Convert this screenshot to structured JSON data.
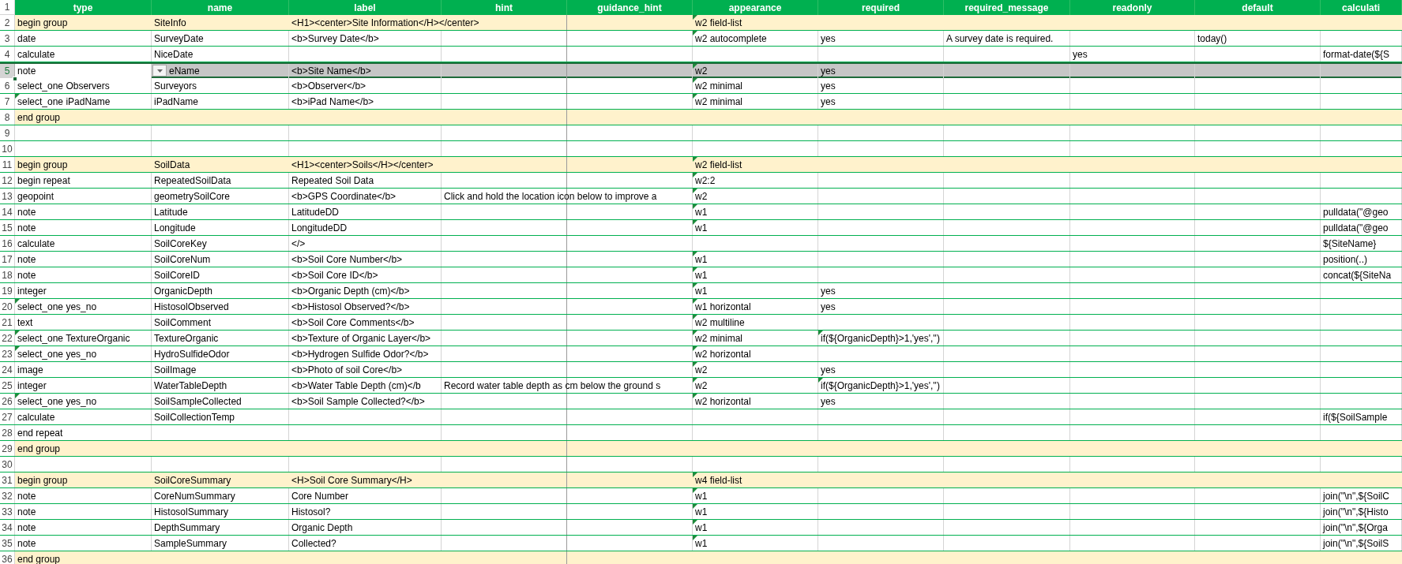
{
  "header": {
    "number": "1",
    "columns": [
      "type",
      "name",
      "label",
      "hint",
      "guidance_hint",
      "appearance",
      "required",
      "required_message",
      "readonly",
      "default",
      "calculati"
    ]
  },
  "rows": [
    {
      "number": "2",
      "kind": "group",
      "selected": false,
      "cells": {
        "type": {
          "text": "begin group",
          "comment": false
        },
        "name": {
          "text": "SiteInfo",
          "comment": false
        },
        "label": {
          "text": "<H1><center>Site Information</H></center>",
          "comment": false
        },
        "appearance": {
          "text": "w2 field-list",
          "comment": true
        }
      }
    },
    {
      "number": "3",
      "kind": "field",
      "selected": false,
      "cells": {
        "type": {
          "text": "date",
          "comment": false
        },
        "name": {
          "text": "SurveyDate",
          "comment": false
        },
        "label": {
          "text": "<b>Survey Date</b>",
          "comment": false
        },
        "appearance": {
          "text": "w2 autocomplete",
          "comment": true
        },
        "required": {
          "text": "yes",
          "comment": false
        },
        "required_message": {
          "text": "A survey date is required.",
          "comment": false
        },
        "default": {
          "text": "today()",
          "comment": false
        }
      }
    },
    {
      "number": "4",
      "kind": "field",
      "selected": false,
      "cells": {
        "type": {
          "text": "calculate",
          "comment": false
        },
        "name": {
          "text": "NiceDate",
          "comment": false
        },
        "readonly": {
          "text": "yes",
          "comment": false
        },
        "calculation": {
          "text": "format-date(${S",
          "comment": false
        }
      }
    },
    {
      "number": "5",
      "kind": "field",
      "selected": true,
      "cells": {
        "type": {
          "text": "note",
          "comment": false
        },
        "name": {
          "text": "eName",
          "comment": false
        },
        "label": {
          "text": "<b>Site Name</b>",
          "comment": false
        },
        "appearance": {
          "text": "w2",
          "comment": true
        },
        "required": {
          "text": "yes",
          "comment": false
        }
      }
    },
    {
      "number": "6",
      "kind": "field",
      "selected": false,
      "cells": {
        "type": {
          "text": "select_one Observers",
          "comment": false
        },
        "name": {
          "text": "Surveyors",
          "comment": false
        },
        "label": {
          "text": "<b>Observer</b>",
          "comment": false
        },
        "appearance": {
          "text": "w2 minimal",
          "comment": true
        },
        "required": {
          "text": "yes",
          "comment": false
        }
      }
    },
    {
      "number": "7",
      "kind": "field",
      "selected": false,
      "cells": {
        "type": {
          "text": "select_one iPadName",
          "comment": true
        },
        "name": {
          "text": "iPadName",
          "comment": false
        },
        "label": {
          "text": "<b>iPad Name</b>",
          "comment": false
        },
        "appearance": {
          "text": "w2 minimal",
          "comment": true
        },
        "required": {
          "text": "yes",
          "comment": false
        }
      }
    },
    {
      "number": "8",
      "kind": "group",
      "selected": false,
      "cells": {
        "type": {
          "text": "end group",
          "comment": false
        }
      }
    },
    {
      "number": "9",
      "kind": "field",
      "selected": false
    },
    {
      "number": "10",
      "kind": "field",
      "selected": false
    },
    {
      "number": "11",
      "kind": "group",
      "selected": false,
      "cells": {
        "type": {
          "text": "begin group",
          "comment": false
        },
        "name": {
          "text": "SoilData",
          "comment": false
        },
        "label": {
          "text": "<H1><center>Soils</H></center>",
          "comment": false
        },
        "appearance": {
          "text": "w2 field-list",
          "comment": true
        }
      }
    },
    {
      "number": "12",
      "kind": "field",
      "selected": false,
      "cells": {
        "type": {
          "text": "begin repeat",
          "comment": false
        },
        "name": {
          "text": "RepeatedSoilData",
          "comment": false
        },
        "label": {
          "text": "Repeated Soil Data",
          "comment": false
        },
        "appearance": {
          "text": "w2:2",
          "comment": true
        }
      }
    },
    {
      "number": "13",
      "kind": "field",
      "selected": false,
      "cells": {
        "type": {
          "text": "geopoint",
          "comment": false
        },
        "name": {
          "text": "geometrySoilCore",
          "comment": false
        },
        "label": {
          "text": "<b>GPS Coordinate</b>",
          "comment": false
        },
        "hint": {
          "text": "Click and hold the location icon below to improve a",
          "comment": false
        },
        "appearance": {
          "text": "w2",
          "comment": true
        }
      }
    },
    {
      "number": "14",
      "kind": "field",
      "selected": false,
      "cells": {
        "type": {
          "text": "note",
          "comment": false
        },
        "name": {
          "text": "Latitude",
          "comment": false
        },
        "label": {
          "text": "LatitudeDD",
          "comment": false
        },
        "appearance": {
          "text": "w1",
          "comment": true
        },
        "calculation": {
          "text": "pulldata(\"@geo",
          "comment": false
        }
      }
    },
    {
      "number": "15",
      "kind": "field",
      "selected": false,
      "cells": {
        "type": {
          "text": "note",
          "comment": false
        },
        "name": {
          "text": "Longitude",
          "comment": false
        },
        "label": {
          "text": "LongitudeDD",
          "comment": false
        },
        "appearance": {
          "text": "w1",
          "comment": true
        },
        "calculation": {
          "text": "pulldata(\"@geo",
          "comment": false
        }
      }
    },
    {
      "number": "16",
      "kind": "field",
      "selected": false,
      "cells": {
        "type": {
          "text": "calculate",
          "comment": false
        },
        "name": {
          "text": "SoilCoreKey",
          "comment": false
        },
        "label": {
          "text": "</>",
          "comment": false
        },
        "calculation": {
          "text": "${SiteName}",
          "comment": false
        }
      }
    },
    {
      "number": "17",
      "kind": "field",
      "selected": false,
      "cells": {
        "type": {
          "text": "note",
          "comment": false
        },
        "name": {
          "text": "SoilCoreNum",
          "comment": false
        },
        "label": {
          "text": "<b>Soil Core Number</b>",
          "comment": false
        },
        "appearance": {
          "text": "w1",
          "comment": true
        },
        "calculation": {
          "text": "position(..)",
          "comment": false
        }
      }
    },
    {
      "number": "18",
      "kind": "field",
      "selected": false,
      "cells": {
        "type": {
          "text": "note",
          "comment": false
        },
        "name": {
          "text": "SoilCoreID",
          "comment": false
        },
        "label": {
          "text": "<b>Soil Core ID</b>",
          "comment": false
        },
        "appearance": {
          "text": "w1",
          "comment": true
        },
        "calculation": {
          "text": "concat(${SiteNa",
          "comment": false
        }
      }
    },
    {
      "number": "19",
      "kind": "field",
      "selected": false,
      "cells": {
        "type": {
          "text": "integer",
          "comment": false
        },
        "name": {
          "text": "OrganicDepth",
          "comment": false
        },
        "label": {
          "text": "<b>Organic Depth (cm)</b>",
          "comment": false
        },
        "appearance": {
          "text": "w1",
          "comment": true
        },
        "required": {
          "text": "yes",
          "comment": false
        }
      }
    },
    {
      "number": "20",
      "kind": "field",
      "selected": false,
      "cells": {
        "type": {
          "text": "select_one yes_no",
          "comment": true
        },
        "name": {
          "text": "HistosolObserved",
          "comment": false
        },
        "label": {
          "text": "<b>Histosol Observed?</b>",
          "comment": false
        },
        "appearance": {
          "text": "w1 horizontal",
          "comment": true
        },
        "required": {
          "text": "yes",
          "comment": false
        }
      }
    },
    {
      "number": "21",
      "kind": "field",
      "selected": false,
      "cells": {
        "type": {
          "text": "text",
          "comment": false
        },
        "name": {
          "text": "SoilComment",
          "comment": false
        },
        "label": {
          "text": "<b>Soil Core Comments</b>",
          "comment": false
        },
        "appearance": {
          "text": "w2 multiline",
          "comment": true
        }
      }
    },
    {
      "number": "22",
      "kind": "field",
      "selected": false,
      "cells": {
        "type": {
          "text": "select_one TextureOrganic",
          "comment": true
        },
        "name": {
          "text": "TextureOrganic",
          "comment": false
        },
        "label": {
          "text": "<b>Texture of Organic Layer</b>",
          "comment": false
        },
        "appearance": {
          "text": "w2 minimal",
          "comment": true
        },
        "required": {
          "text": "if(${OrganicDepth}>1,'yes','')",
          "comment": true
        }
      }
    },
    {
      "number": "23",
      "kind": "field",
      "selected": false,
      "cells": {
        "type": {
          "text": "select_one yes_no",
          "comment": true
        },
        "name": {
          "text": "HydroSulfideOdor",
          "comment": false
        },
        "label": {
          "text": "<b>Hydrogen Sulfide Odor?</b>",
          "comment": false
        },
        "appearance": {
          "text": "w2 horizontal",
          "comment": true
        }
      }
    },
    {
      "number": "24",
      "kind": "field",
      "selected": false,
      "cells": {
        "type": {
          "text": "image",
          "comment": false
        },
        "name": {
          "text": "SoilImage",
          "comment": false
        },
        "label": {
          "text": "<b>Photo of soil Core</b>",
          "comment": false
        },
        "appearance": {
          "text": "w2",
          "comment": true
        },
        "required": {
          "text": "yes",
          "comment": false
        }
      }
    },
    {
      "number": "25",
      "kind": "field",
      "selected": false,
      "cells": {
        "type": {
          "text": "integer",
          "comment": false
        },
        "name": {
          "text": "WaterTableDepth",
          "comment": false
        },
        "label": {
          "text": "<b>Water Table Depth (cm)</b",
          "comment": false
        },
        "hint": {
          "text": "Record water table depth as cm below the ground s",
          "comment": false
        },
        "appearance": {
          "text": "w2",
          "comment": true
        },
        "required": {
          "text": "if(${OrganicDepth}>1,'yes','')",
          "comment": true
        }
      }
    },
    {
      "number": "26",
      "kind": "field",
      "selected": false,
      "cells": {
        "type": {
          "text": "select_one yes_no",
          "comment": true
        },
        "name": {
          "text": "SoilSampleCollected",
          "comment": false
        },
        "label": {
          "text": "<b>Soil Sample Collected?</b>",
          "comment": false
        },
        "appearance": {
          "text": "w2 horizontal",
          "comment": true
        },
        "required": {
          "text": "yes",
          "comment": false
        }
      }
    },
    {
      "number": "27",
      "kind": "field",
      "selected": false,
      "cells": {
        "type": {
          "text": "calculate",
          "comment": false
        },
        "name": {
          "text": "SoilCollectionTemp",
          "comment": false
        },
        "calculation": {
          "text": "if(${SoilSample",
          "comment": false
        }
      }
    },
    {
      "number": "28",
      "kind": "field",
      "selected": false,
      "cells": {
        "type": {
          "text": "end repeat",
          "comment": false
        }
      }
    },
    {
      "number": "29",
      "kind": "group",
      "selected": false,
      "cells": {
        "type": {
          "text": "end group",
          "comment": false
        }
      }
    },
    {
      "number": "30",
      "kind": "field",
      "selected": false
    },
    {
      "number": "31",
      "kind": "group",
      "selected": false,
      "cells": {
        "type": {
          "text": "begin group",
          "comment": false
        },
        "name": {
          "text": "SoilCoreSummary",
          "comment": false
        },
        "label": {
          "text": "<H>Soil Core Summary</H>",
          "comment": false
        },
        "appearance": {
          "text": "w4 field-list",
          "comment": true
        }
      }
    },
    {
      "number": "32",
      "kind": "field",
      "selected": false,
      "cells": {
        "type": {
          "text": "note",
          "comment": false
        },
        "name": {
          "text": "CoreNumSummary",
          "comment": false
        },
        "label": {
          "text": "Core Number",
          "comment": false
        },
        "appearance": {
          "text": "w1",
          "comment": true
        },
        "calculation": {
          "text": "join(\"\\n\",${SoilC",
          "comment": false
        }
      }
    },
    {
      "number": "33",
      "kind": "field",
      "selected": false,
      "cells": {
        "type": {
          "text": "note",
          "comment": false
        },
        "name": {
          "text": "HistosolSummary",
          "comment": false
        },
        "label": {
          "text": "Histosol?",
          "comment": false
        },
        "appearance": {
          "text": "w1",
          "comment": true
        },
        "calculation": {
          "text": "join(\"\\n\",${Histo",
          "comment": false
        }
      }
    },
    {
      "number": "34",
      "kind": "field",
      "selected": false,
      "cells": {
        "type": {
          "text": "note",
          "comment": false
        },
        "name": {
          "text": "DepthSummary",
          "comment": false
        },
        "label": {
          "text": "Organic Depth",
          "comment": false
        },
        "appearance": {
          "text": "w1",
          "comment": true
        },
        "calculation": {
          "text": "join(\"\\n\",${Orga",
          "comment": false
        }
      }
    },
    {
      "number": "35",
      "kind": "field",
      "selected": false,
      "cells": {
        "type": {
          "text": "note",
          "comment": false
        },
        "name": {
          "text": "SampleSummary",
          "comment": false
        },
        "label": {
          "text": "Collected?",
          "comment": false
        },
        "appearance": {
          "text": "w1",
          "comment": true
        },
        "calculation": {
          "text": "join(\"\\n\",${SoilS",
          "comment": false
        }
      }
    },
    {
      "number": "36",
      "kind": "group",
      "selected": false,
      "cells": {
        "type": {
          "text": "end group",
          "comment": false
        }
      }
    }
  ]
}
